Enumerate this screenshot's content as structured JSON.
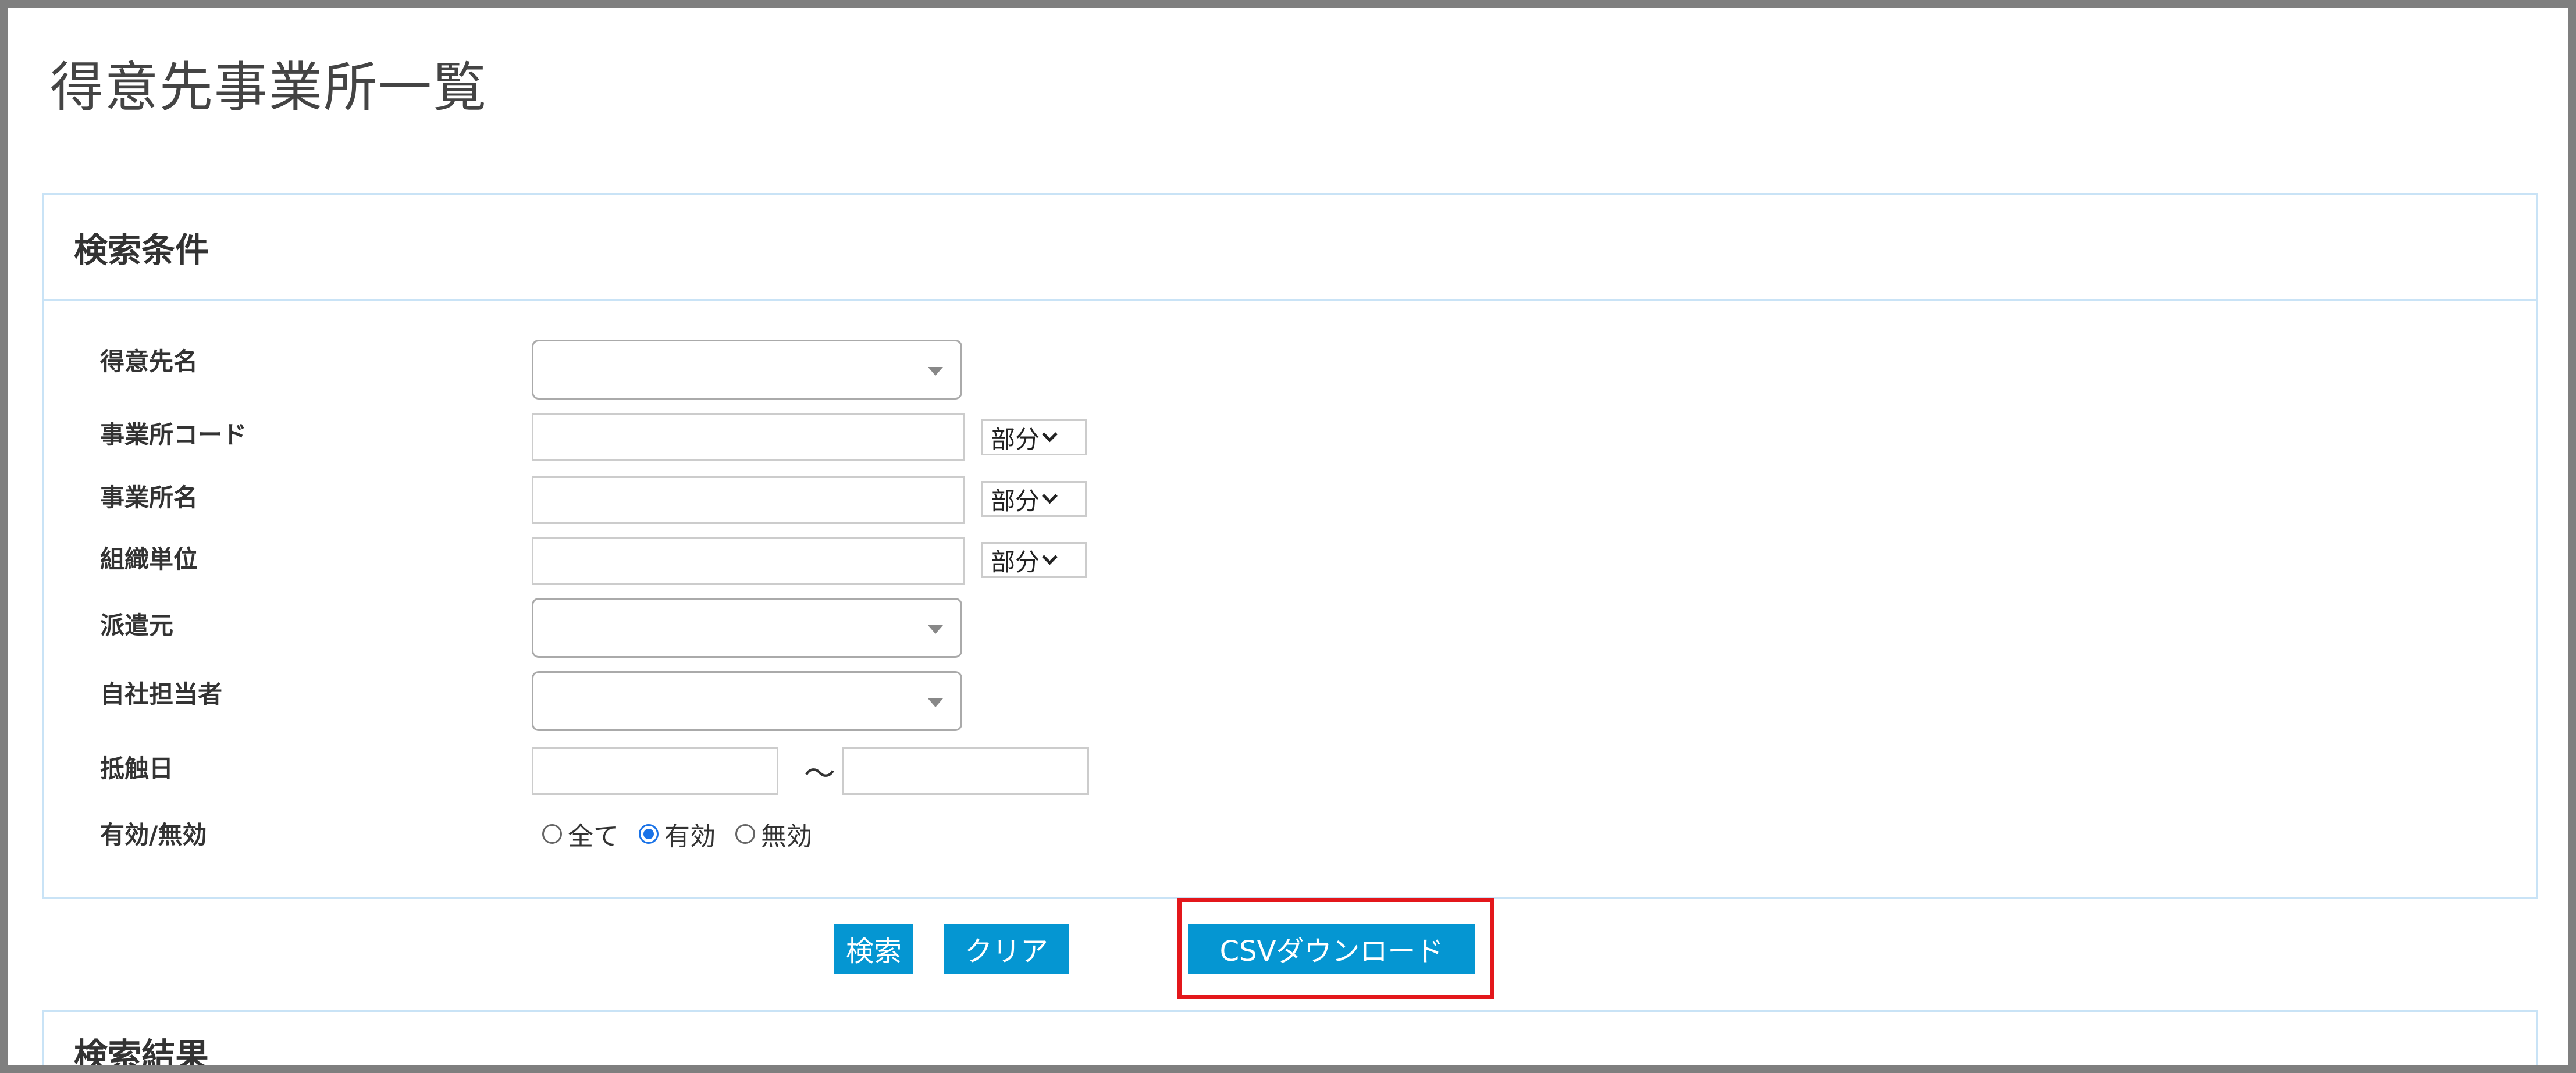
{
  "page": {
    "title": "得意先事業所一覧"
  },
  "search_panel": {
    "heading": "検索条件",
    "fields": {
      "customer_name": {
        "label": "得意先名",
        "value": ""
      },
      "office_code": {
        "label": "事業所コード",
        "value": "",
        "match_mode": "部分"
      },
      "office_name": {
        "label": "事業所名",
        "value": "",
        "match_mode": "部分"
      },
      "org_unit": {
        "label": "組織単位",
        "value": "",
        "match_mode": "部分"
      },
      "dispatch_source": {
        "label": "派遣元",
        "value": ""
      },
      "staff_in_charge": {
        "label": "自社担当者",
        "value": ""
      },
      "contact_date": {
        "label": "抵触日",
        "from": "",
        "separator": "〜",
        "to": ""
      },
      "active_flag": {
        "label": "有効/無効",
        "options": [
          "全て",
          "有効",
          "無効"
        ],
        "selected": "有効"
      }
    }
  },
  "actions": {
    "search_label": "検索",
    "clear_label": "クリア",
    "csv_label": "CSVダウンロード"
  },
  "results_panel": {
    "heading": "検索結果"
  },
  "colors": {
    "button_bg": "#0596d2",
    "panel_border": "#c9e3f6",
    "highlight_border": "#e3171b",
    "radio_checked": "#1a73e8"
  }
}
